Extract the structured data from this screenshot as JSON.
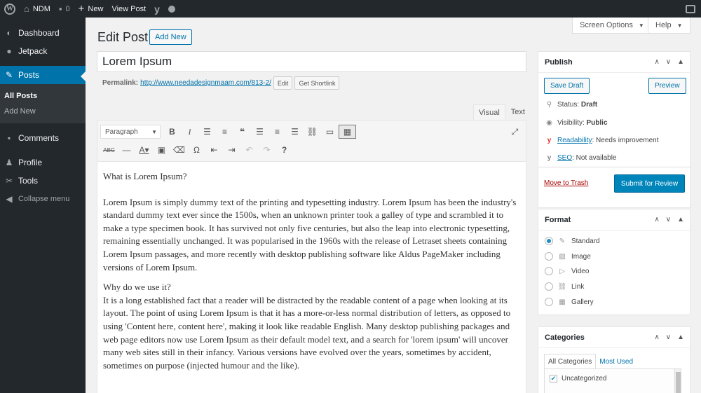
{
  "adminbar": {
    "site_name": "NDM",
    "comments_count": "0",
    "new_label": "New",
    "view_post_label": "View Post"
  },
  "sidebar": {
    "items": [
      {
        "label": "Dashboard",
        "icon": "dashboard-icon"
      },
      {
        "label": "Jetpack",
        "icon": "jetpack-icon"
      },
      {
        "label": "Posts",
        "icon": "pin-icon"
      },
      {
        "label": "Comments",
        "icon": "comment-icon"
      },
      {
        "label": "Profile",
        "icon": "user-icon"
      },
      {
        "label": "Tools",
        "icon": "wrench-icon"
      },
      {
        "label": "Collapse menu",
        "icon": "collapse-icon"
      }
    ],
    "submenu": [
      "All Posts",
      "Add New"
    ]
  },
  "header": {
    "title": "Edit Post",
    "add_new": "Add New",
    "screen_options": "Screen Options",
    "help": "Help"
  },
  "post": {
    "title": "Lorem Ipsum",
    "permalink_label": "Permalink:",
    "permalink_url": "http://www.needadesignmaam.com/813-2/",
    "edit_label": "Edit",
    "shortlink_label": "Get Shortlink"
  },
  "editor": {
    "tab_visual": "Visual",
    "tab_text": "Text",
    "format_select": "Paragraph",
    "paragraphs": [
      "What is Lorem Ipsum?",
      "Lorem Ipsum is simply dummy text of the printing and typesetting industry. Lorem Ipsum has been the industry's standard dummy text ever since the 1500s, when an unknown printer took a galley of type and scrambled it to make a type specimen book. It has survived not only five centuries, but also the leap into electronic typesetting, remaining essentially unchanged. It was popularised in the 1960s with the release of Letraset sheets containing Lorem Ipsum passages, and more recently with desktop publishing software like Aldus PageMaker including versions of Lorem Ipsum.",
      "Why do we use it?",
      "It is a long established fact that a reader will be distracted by the readable content of a page when looking at its layout. The point of using Lorem Ipsum is that it has a more-or-less normal distribution of letters, as opposed to using 'Content here, content here', making it look like readable English. Many desktop publishing packages and web page editors now use Lorem Ipsum as their default model text, and a search for 'lorem ipsum' will uncover many web sites still in their infancy. Various versions have evolved over the years, sometimes by accident, sometimes on purpose (injected humour and the like)."
    ]
  },
  "publish": {
    "title": "Publish",
    "save_draft": "Save Draft",
    "preview": "Preview",
    "status_label": "Status:",
    "status_value": "Draft",
    "visibility_label": "Visibility:",
    "visibility_value": "Public",
    "readability_label": "Readability",
    "readability_value": ": Needs improvement",
    "seo_label": "SEO",
    "seo_value": ": Not available",
    "trash": "Move to Trash",
    "submit": "Submit for Review"
  },
  "format": {
    "title": "Format",
    "options": [
      "Standard",
      "Image",
      "Video",
      "Link",
      "Gallery"
    ],
    "selected": "Standard"
  },
  "categories": {
    "title": "Categories",
    "tab_all": "All Categories",
    "tab_used": "Most Used",
    "items": [
      {
        "label": "Uncategorized",
        "checked": true
      }
    ]
  },
  "colors": {
    "adminbar": "#23282d",
    "accent": "#0073aa",
    "primary_button": "#0085ba"
  }
}
